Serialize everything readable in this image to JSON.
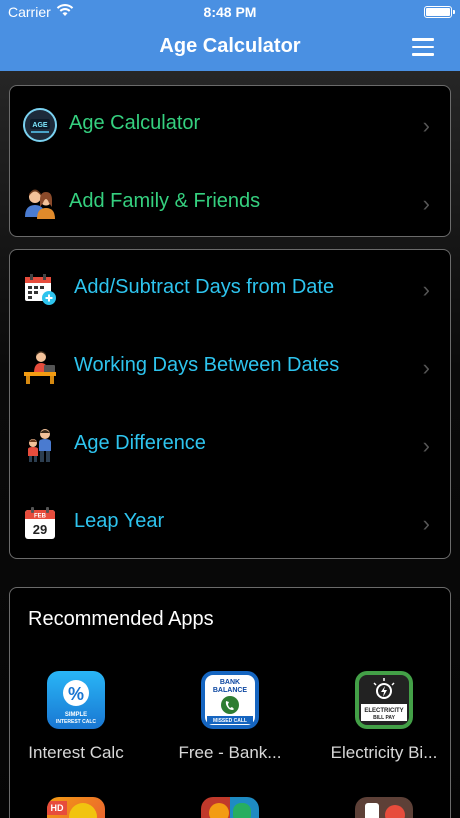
{
  "status_bar": {
    "carrier": "Carrier",
    "time": "8:48 PM"
  },
  "nav": {
    "title": "Age Calculator"
  },
  "section1": [
    {
      "label": "Age Calculator",
      "icon": "age-calculator-icon"
    },
    {
      "label": "Add Family & Friends",
      "icon": "family-friends-icon"
    }
  ],
  "section2": [
    {
      "label": "Add/Subtract Days from Date",
      "icon": "calendar-add-icon"
    },
    {
      "label": "Working Days Between Dates",
      "icon": "working-person-icon"
    },
    {
      "label": "Age Difference",
      "icon": "age-difference-icon"
    },
    {
      "label": "Leap Year",
      "icon": "leap-year-calendar-icon",
      "badge_month": "FEB",
      "badge_day": "29"
    }
  ],
  "recommended": {
    "title": "Recommended Apps",
    "apps": [
      {
        "name": "Interest Calc",
        "icon_text": "SIMPLE INTEREST CALC"
      },
      {
        "name": "Free - Bank...",
        "icon_text_top": "BANK BALANCE",
        "icon_text_bottom": "MISSED CALL"
      },
      {
        "name": "Electricity Bi...",
        "icon_text": "ELECTRICITY BILL PAY"
      }
    ],
    "second_row_badge": "HD"
  },
  "colors": {
    "nav": "#4a90e2",
    "green_label": "#35d07f",
    "blue_label": "#2ec4ee"
  }
}
